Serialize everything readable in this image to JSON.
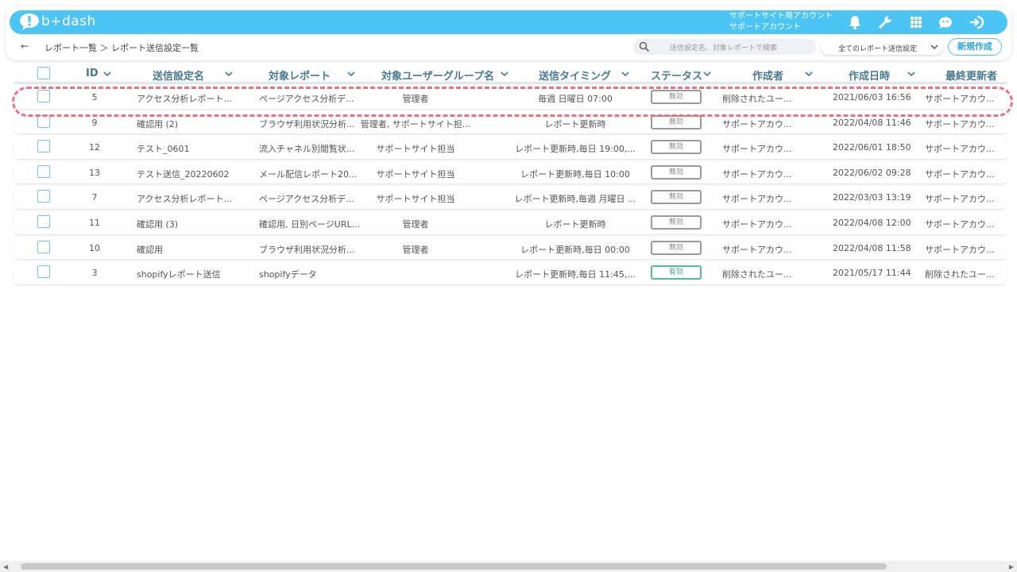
{
  "header": {
    "logo_text": "b+dash",
    "account_line1": "サポートサイト用アカウント",
    "account_line2": "サポートアカウント"
  },
  "breadcrumb": {
    "back": "←",
    "path": "レポート一覧 ＞ レポート送信設定一覧"
  },
  "toolbar": {
    "search_placeholder": "送信設定名、対象レポートで検索",
    "filter_value": "全てのレポート送信設定",
    "new_button": "新規作成"
  },
  "table": {
    "columns": {
      "id": "ID",
      "name": "送信設定名",
      "report": "対象レポート",
      "group": "対象ユーザーグループ名",
      "timing": "送信タイミング",
      "status": "ステータス",
      "creator": "作成者",
      "created": "作成日時",
      "updater": "最終更新者"
    },
    "rows": [
      {
        "id": "5",
        "name": "アクセス分析レポート...",
        "report": "ページアクセス分析デ...",
        "group": "管理者",
        "timing": "毎週 日曜日 07:00",
        "status": "無効",
        "active": false,
        "creator": "削除されたユー...",
        "created": "2021/06/03 16:56",
        "updater": "サポートアカウ..."
      },
      {
        "id": "9",
        "name": "確認用 (2)",
        "report": "ブラウザ利用状況分析...",
        "group": "管理者, サポートサイト担...",
        "timing": "レポート更新時",
        "status": "無効",
        "active": false,
        "creator": "サポートアカウ...",
        "created": "2022/04/08 11:46",
        "updater": "サポートアカウ..."
      },
      {
        "id": "12",
        "name": "テスト_0601",
        "report": "流入チャネル別閲覧状...",
        "group": "サポートサイト担当",
        "timing": "レポート更新時,毎日 19:00,...",
        "status": "無効",
        "active": false,
        "creator": "サポートアカウ...",
        "created": "2022/06/01 18:50",
        "updater": "サポートアカウ..."
      },
      {
        "id": "13",
        "name": "テスト送信_20220602",
        "report": "メール配信レポート20...",
        "group": "サポートサイト担当",
        "timing": "レポート更新時,毎日 10:00",
        "status": "無効",
        "active": false,
        "creator": "サポートアカウ...",
        "created": "2022/06/02 09:28",
        "updater": "サポートアカウ..."
      },
      {
        "id": "7",
        "name": "アクセス分析レポート...",
        "report": "ページアクセス分析デ...",
        "group": "サポートサイト担当",
        "timing": "レポート更新時,毎週 月曜日 ...",
        "status": "無効",
        "active": false,
        "creator": "サポートアカウ...",
        "created": "2022/03/03 13:19",
        "updater": "サポートアカウ..."
      },
      {
        "id": "11",
        "name": "確認用 (3)",
        "report": "確認用, 日別ページURL...",
        "group": "管理者",
        "timing": "レポート更新時",
        "status": "無効",
        "active": false,
        "creator": "サポートアカウ...",
        "created": "2022/04/08 12:00",
        "updater": "サポートアカウ..."
      },
      {
        "id": "10",
        "name": "確認用",
        "report": "ブラウザ利用状況分析...",
        "group": "管理者",
        "timing": "レポート更新時,毎日 00:00",
        "status": "無効",
        "active": false,
        "creator": "サポートアカウ...",
        "created": "2022/04/08 11:58",
        "updater": "サポートアカウ..."
      },
      {
        "id": "3",
        "name": "shopifyレポート送信",
        "report": "shopifyデータ",
        "group": "",
        "timing": "レポート更新時,毎日 11:45,...",
        "status": "有効",
        "active": true,
        "creator": "削除されたユー...",
        "created": "2021/05/17 11:44",
        "updater": "削除されたユー..."
      }
    ]
  },
  "colors": {
    "brand": "#4cc4f4",
    "highlight": "#f07080",
    "active_status": "#4dbf9a"
  }
}
